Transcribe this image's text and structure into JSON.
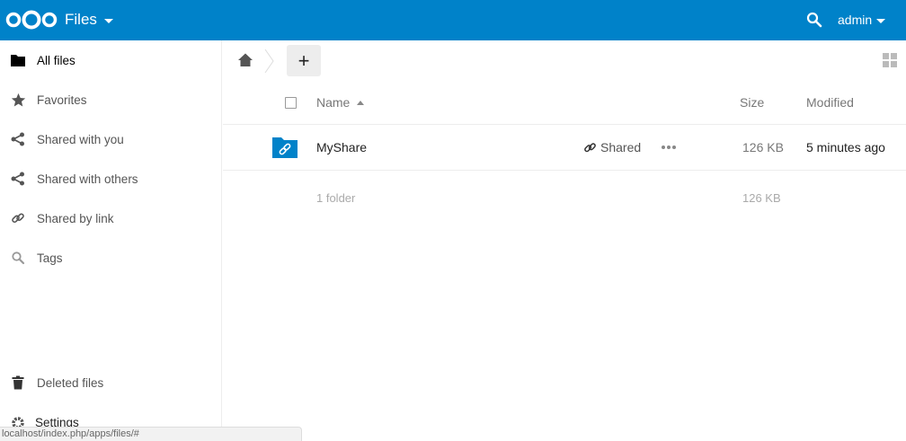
{
  "header": {
    "app_name": "Files",
    "user": "admin",
    "colors": {
      "primary": "#0082c9",
      "text": "#ffffff"
    }
  },
  "sidebar": {
    "items": [
      {
        "label": "All files",
        "icon": "folder-icon",
        "active": true
      },
      {
        "label": "Favorites",
        "icon": "star-icon"
      },
      {
        "label": "Shared with you",
        "icon": "share-icon"
      },
      {
        "label": "Shared with others",
        "icon": "share-icon"
      },
      {
        "label": "Shared by link",
        "icon": "link-icon"
      },
      {
        "label": "Tags",
        "icon": "search-icon"
      }
    ],
    "deleted_files": "Deleted files",
    "settings": "Settings"
  },
  "statusbar": {
    "url": "localhost/index.php/apps/files/#"
  },
  "controls": {
    "new_label": "+"
  },
  "table": {
    "headers": {
      "name": "Name",
      "size": "Size",
      "modified": "Modified"
    },
    "rows": [
      {
        "name": "MyShare",
        "share_label": "Shared",
        "size": "126 KB",
        "modified": "5 minutes ago",
        "icon": "shared-folder-icon"
      }
    ],
    "summary": {
      "count": "1 folder",
      "size": "126 KB"
    }
  }
}
